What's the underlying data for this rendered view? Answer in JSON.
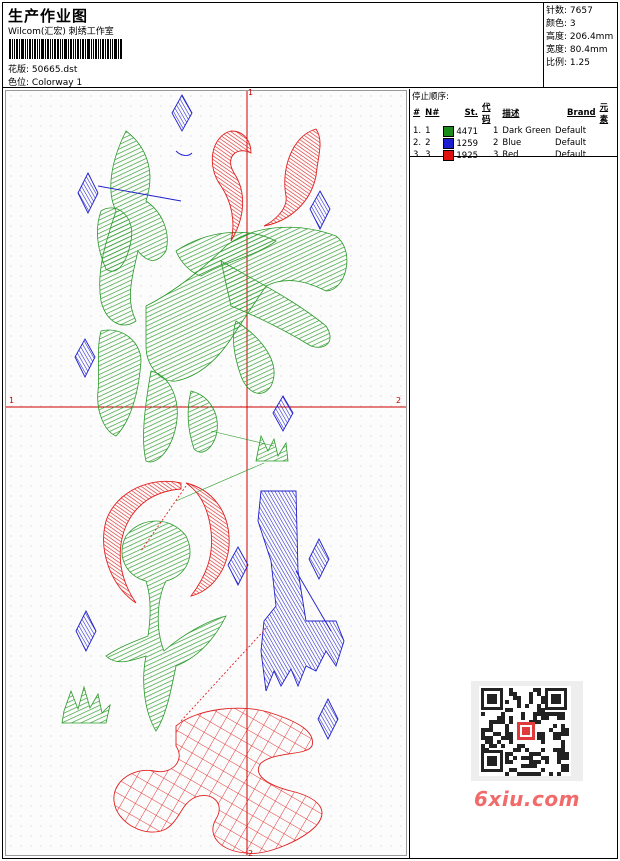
{
  "header": {
    "title": "生产作业图",
    "company": "Wilcom(汇宏) 刺绣工作室",
    "design_label": "花版:",
    "design_value": "50665.dst",
    "colorway_label": "色位:",
    "colorway_value": "Colorway 1"
  },
  "stats": {
    "stitches_label": "针数:",
    "stitches_value": "7657",
    "colors_label": "颜色:",
    "colors_value": "3",
    "height_label": "高度:",
    "height_value": "206.4mm",
    "width_label": "宽度:",
    "width_value": "80.4mm",
    "scale_label": "比例:",
    "scale_value": "1.25"
  },
  "stop_panel": {
    "title": "停止顺序:",
    "headers": [
      "#",
      "N#",
      "St.",
      "代码",
      "描述",
      "Brand",
      "元素"
    ],
    "rows": [
      {
        "index": "1.",
        "n": "1",
        "stitches": "4471",
        "code": "1",
        "description": "Dark Green",
        "brand": "Default",
        "color": "#1a8a1a"
      },
      {
        "index": "2.",
        "n": "2",
        "stitches": "1259",
        "code": "2",
        "description": "Blue",
        "brand": "Default",
        "color": "#1c1cd0"
      },
      {
        "index": "3.",
        "n": "3",
        "stitches": "1925",
        "code": "3",
        "description": "Red",
        "brand": "Default",
        "color": "#e01010"
      }
    ]
  },
  "axes": {
    "top": "1",
    "left": "1",
    "right": "2",
    "bottom": "2"
  },
  "watermark": "6xiu.com",
  "colors": {
    "green": "#2a9a2a",
    "blue": "#1f1fcc",
    "red": "#e02020",
    "axis": "#d00000"
  }
}
